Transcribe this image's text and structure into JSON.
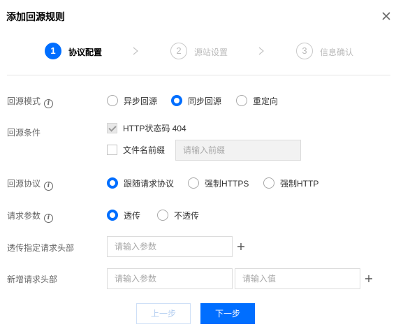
{
  "dialog": {
    "title": "添加回源规则"
  },
  "steps": [
    {
      "number": "1",
      "label": "协议配置"
    },
    {
      "number": "2",
      "label": "源站设置"
    },
    {
      "number": "3",
      "label": "信息确认"
    }
  ],
  "origin_mode": {
    "label": "回源模式",
    "options": [
      "异步回源",
      "同步回源",
      "重定向"
    ],
    "selected": "同步回源"
  },
  "origin_condition": {
    "label": "回源条件",
    "http_status": {
      "label": "HTTP状态码 404",
      "checked": true,
      "disabled": true
    },
    "file_prefix": {
      "label": "文件名前缀",
      "checked": false,
      "placeholder": "请输入前缀"
    }
  },
  "origin_protocol": {
    "label": "回源协议",
    "options": [
      "跟随请求协议",
      "强制HTTPS",
      "强制HTTP"
    ],
    "selected": "跟随请求协议"
  },
  "request_params": {
    "label": "请求参数",
    "options": [
      "透传",
      "不透传"
    ],
    "selected": "透传"
  },
  "passthrough_headers": {
    "label": "透传指定请求头部",
    "placeholder": "请输入参数"
  },
  "new_headers": {
    "label": "新增请求头部",
    "param_placeholder": "请输入参数",
    "value_placeholder": "请输入值"
  },
  "footer": {
    "prev_label": "上一步",
    "next_label": "下一步"
  },
  "colors": {
    "primary": "#006eff",
    "disabled_primary": "#b2cdf0"
  }
}
